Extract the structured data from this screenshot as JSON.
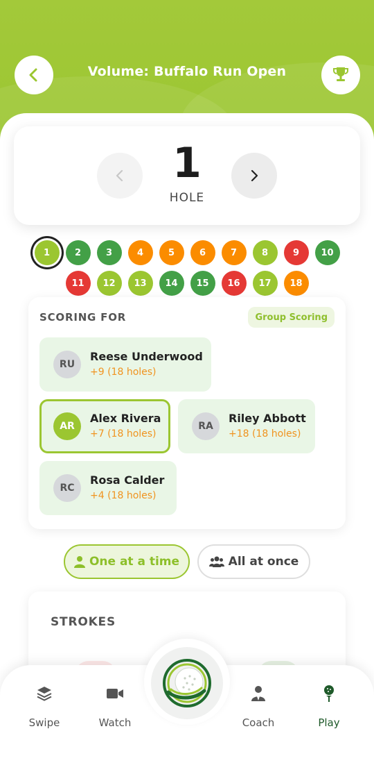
{
  "header": {
    "title": "Volume: Buffalo Run Open",
    "back_icon": "chevron-left-icon",
    "trophy_icon": "trophy-icon",
    "accent_color": "#9bc631"
  },
  "hole_selector": {
    "number": "1",
    "label": "HOLE",
    "prev_icon": "chevron-left-icon",
    "next_icon": "chevron-right-icon"
  },
  "holes": [
    {
      "n": "1",
      "color": "#9bc631",
      "active": true
    },
    {
      "n": "2",
      "color": "#43a047"
    },
    {
      "n": "3",
      "color": "#43a047"
    },
    {
      "n": "4",
      "color": "#fb8c00"
    },
    {
      "n": "5",
      "color": "#fb8c00"
    },
    {
      "n": "6",
      "color": "#fb8c00"
    },
    {
      "n": "7",
      "color": "#fb8c00"
    },
    {
      "n": "8",
      "color": "#9bc631"
    },
    {
      "n": "9",
      "color": "#e53935"
    },
    {
      "n": "10",
      "color": "#43a047"
    },
    {
      "n": "11",
      "color": "#e53935"
    },
    {
      "n": "12",
      "color": "#9bc631"
    },
    {
      "n": "13",
      "color": "#9bc631"
    },
    {
      "n": "14",
      "color": "#43a047"
    },
    {
      "n": "15",
      "color": "#43a047"
    },
    {
      "n": "16",
      "color": "#e53935"
    },
    {
      "n": "17",
      "color": "#9bc631"
    },
    {
      "n": "18",
      "color": "#fb8c00"
    }
  ],
  "scoring": {
    "title": "SCORING FOR",
    "group_label": "Group Scoring",
    "players": [
      {
        "initials": "RU",
        "name": "Reese Underwood",
        "score": "+9 (18 holes)"
      },
      {
        "initials": "AR",
        "name": "Alex Rivera",
        "score": "+7 (18 holes)",
        "selected": true
      },
      {
        "initials": "RA",
        "name": "Riley Abbott",
        "score": "+18 (18 holes)"
      },
      {
        "initials": "RC",
        "name": "Rosa Calder",
        "score": "+4 (18 holes)"
      }
    ]
  },
  "modes": {
    "one_label": "One at a time",
    "one_icon": "user-icon",
    "all_label": "All at once",
    "all_icon": "users-icon"
  },
  "strokes": {
    "title": "STROKES"
  },
  "bottom_nav": {
    "items": [
      {
        "label": "Swipe",
        "icon": "layers-icon"
      },
      {
        "label": "Watch",
        "icon": "video-camera-icon"
      },
      {
        "label": "Coach",
        "icon": "coach-icon"
      },
      {
        "label": "Play",
        "icon": "golf-tee-icon",
        "active": true
      }
    ],
    "center_icon": "golf-ball-logo-icon"
  }
}
